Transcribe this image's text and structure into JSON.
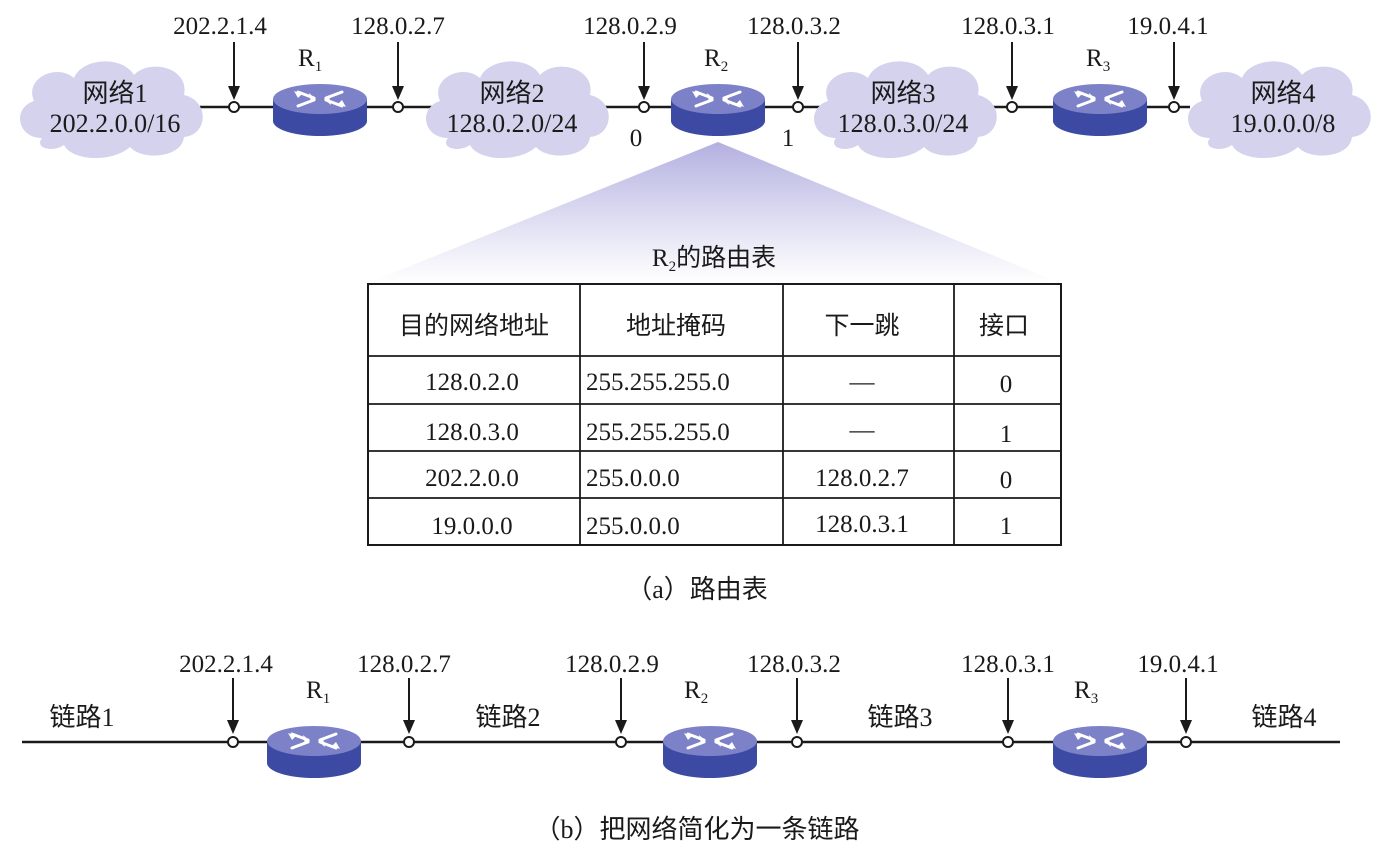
{
  "part_a": {
    "networks": [
      {
        "name": "网络1",
        "prefix": "202.2.0.0/16"
      },
      {
        "name": "网络2",
        "prefix": "128.0.2.0/24"
      },
      {
        "name": "网络3",
        "prefix": "128.0.3.0/24"
      },
      {
        "name": "网络4",
        "prefix": "19.0.0.0/8"
      }
    ],
    "routers": [
      {
        "letter": "R",
        "sub": "1"
      },
      {
        "letter": "R",
        "sub": "2"
      },
      {
        "letter": "R",
        "sub": "3"
      }
    ],
    "addresses": [
      "202.2.1.4",
      "128.0.2.7",
      "128.0.2.9",
      "128.0.3.2",
      "128.0.3.1",
      "19.0.4.1"
    ],
    "interfaces": [
      "0",
      "1"
    ],
    "table_title": {
      "letter": "R",
      "sub": "2",
      "text": "的路由表"
    },
    "table": {
      "headers": [
        "目的网络地址",
        "地址掩码",
        "下一跳",
        "接口"
      ],
      "rows": [
        [
          "128.0.2.0",
          "255.255.255.0",
          "—",
          "0"
        ],
        [
          "128.0.3.0",
          "255.255.255.0",
          "—",
          "1"
        ],
        [
          "202.2.0.0",
          "255.0.0.0",
          "128.0.2.7",
          "0"
        ],
        [
          "19.0.0.0",
          "255.0.0.0",
          "128.0.3.1",
          "1"
        ]
      ]
    },
    "caption": "（a）路由表"
  },
  "part_b": {
    "links": [
      "链路1",
      "链路2",
      "链路3",
      "链路4"
    ],
    "routers": [
      {
        "letter": "R",
        "sub": "1"
      },
      {
        "letter": "R",
        "sub": "2"
      },
      {
        "letter": "R",
        "sub": "3"
      }
    ],
    "addresses": [
      "202.2.1.4",
      "128.0.2.7",
      "128.0.2.9",
      "128.0.3.2",
      "128.0.3.1",
      "19.0.4.1"
    ],
    "caption": "（b）把网络简化为一条链路"
  },
  "colors": {
    "cloud": "#d4d2ec",
    "router_top": "#7a7fc6",
    "router_side": "#3d4aa3",
    "router_arrow": "#ffffff",
    "funnel_top": "#b9b6e2",
    "line": "#1a1a1a"
  }
}
